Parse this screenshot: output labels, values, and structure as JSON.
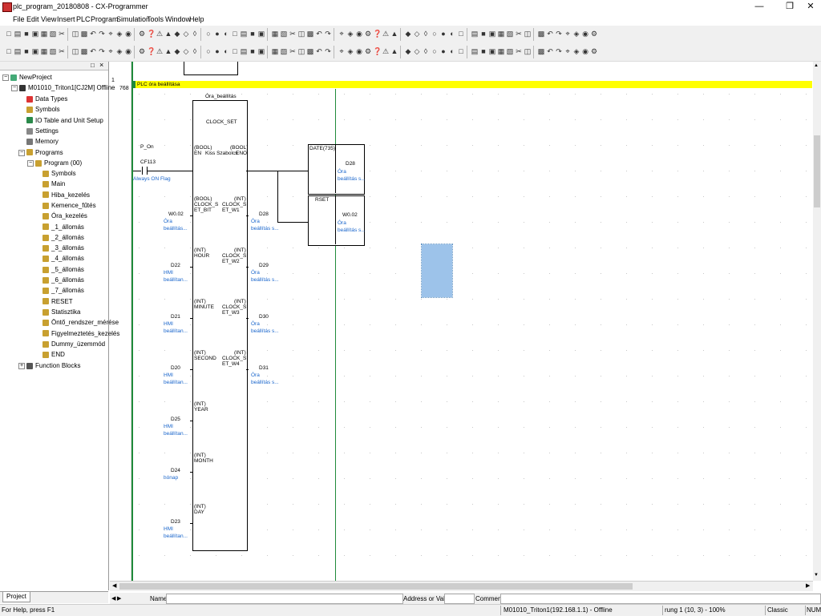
{
  "window": {
    "title": "plc_program_20180808 - CX-Programmer",
    "min": "—",
    "restore": "❐",
    "close": "✕"
  },
  "menu": [
    "File",
    "Edit",
    "View",
    "Insert",
    "PLC",
    "Program",
    "Simulation",
    "Tools",
    "Window",
    "Help"
  ],
  "tree": {
    "root": "NewProject",
    "plc": "M01010_Triton1[CJ2M] Offline",
    "items": [
      "Data Types",
      "Symbols",
      "IO Table and Unit Setup",
      "Settings",
      "Memory",
      "Programs"
    ],
    "program": "Program (00)",
    "sections": [
      "Symbols",
      "Main",
      "Hiba_kezelés",
      "Kemence_fűtés",
      "Óra_kezelés",
      "_1_állomás",
      "_2_állomás",
      "_3_állomás",
      "_4_állomás",
      "_5_állomás",
      "_6_állomás",
      "_7_állomás",
      "RESET",
      "Statisztika",
      "Öntő_rendszer_mérése",
      "Figyelmeztetés_kezelés",
      "Dummy_üzemmód",
      "END"
    ],
    "function_blocks": "Function Blocks",
    "tab": "Project"
  },
  "ladder": {
    "rung_index": "1",
    "rung_step": "768",
    "rung_comment": "PLC óra beállítása",
    "fb_instance": "Óra_beállítás",
    "fb_name": "CLOCK_SET",
    "fb_author": "Kiss Szabolcs",
    "contact": {
      "symbol": "P_On",
      "address": "CF113",
      "comment": "Always ON Flag"
    },
    "en": {
      "type": "(BOOL)",
      "name": "EN"
    },
    "eno": {
      "type": "(BOOL)",
      "name": "ENO"
    },
    "inputs": [
      {
        "type": "(BOOL)",
        "name1": "CLOCK_S",
        "name2": "ET_BIT",
        "addr": "W0.02",
        "c1": "Óra",
        "c2": "beállítás..."
      },
      {
        "type": "(INT)",
        "name1": "HOUR",
        "name2": "",
        "addr": "D22",
        "c1": "HMI",
        "c2": "beállítan..."
      },
      {
        "type": "(INT)",
        "name1": "MINUTE",
        "name2": "",
        "addr": "D21",
        "c1": "HMI",
        "c2": "beállítan..."
      },
      {
        "type": "(INT)",
        "name1": "SECOND",
        "name2": "",
        "addr": "D20",
        "c1": "HMI",
        "c2": "beállítan..."
      },
      {
        "type": "(INT)",
        "name1": "YEAR",
        "name2": "",
        "addr": "D25",
        "c1": "HMI",
        "c2": "beállítan..."
      },
      {
        "type": "(INT)",
        "name1": "MONTH",
        "name2": "",
        "addr": "D24",
        "c1": "hónap",
        "c2": ""
      },
      {
        "type": "(INT)",
        "name1": "DAY",
        "name2": "",
        "addr": "D23",
        "c1": "HMI",
        "c2": "beállítan..."
      }
    ],
    "outputs": [
      {
        "type": "(INT)",
        "name1": "CLOCK_S",
        "name2": "ET_W1",
        "addr": "D28",
        "c1": "Óra",
        "c2": "beállítás s..."
      },
      {
        "type": "(INT)",
        "name1": "CLOCK_S",
        "name2": "ET_W2",
        "addr": "D29",
        "c1": "Óra",
        "c2": "beállítás s..."
      },
      {
        "type": "(INT)",
        "name1": "CLOCK_S",
        "name2": "ET_W3",
        "addr": "D30",
        "c1": "Óra",
        "c2": "beállítás s..."
      },
      {
        "type": "(INT)",
        "name1": "CLOCK_S",
        "name2": "ET_W4",
        "addr": "D31",
        "c1": "Óra",
        "c2": "beállítás s..."
      }
    ],
    "date_instr": {
      "name": "DATE(735)",
      "op": "D28",
      "c1": "Óra",
      "c2": "beállítás s..."
    },
    "rset_instr": {
      "name": "RSET",
      "op": "W0.02",
      "c1": "Óra",
      "c2": "beállítás s..."
    }
  },
  "infobar": {
    "name_label": "Name:",
    "addr_label": "Address or Value:",
    "comment_label": "Comment:"
  },
  "status": {
    "help": "For Help, press F1",
    "connection": "M01010_Triton1(192.168.1.1) - Offline",
    "position": "rung 1 (10, 3) - 100%",
    "mode": "Classic",
    "num": "NUM"
  },
  "colors": {
    "rung_comment_bg": "#ffff00",
    "bus": "#1f8a3a",
    "selection": "#9dc3ea",
    "comment_text": "#1a66cc"
  }
}
